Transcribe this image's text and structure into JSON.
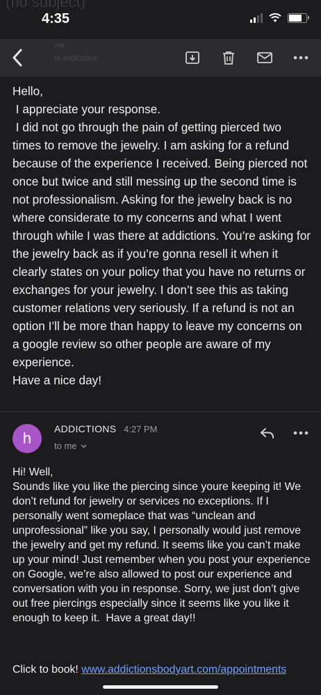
{
  "status_bar": {
    "time": "4:35",
    "ghost_subject": "(no subject)"
  },
  "toolbar": {
    "ghost_sender": "me",
    "ghost_sender_line2": "to addictions"
  },
  "email_body": {
    "text": "Hello,\n I appreciate your response.\n I did not go through the pain of getting pierced two times to remove the jewelry. I am asking for a refund because of the experience I received. Being pierced not once but twice and still messing up the second time is not professionalism. Asking for the jewelry back is no where considerate to my concerns and what I went through while I was there at addictions. You’re asking for the jewelry back as if you’re gonna resell it when it clearly states on your policy that you have no returns or exchanges for your jewelry. I don’t see this as taking customer relations very seriously. If a refund is not an option I’ll be more than happy to leave my concerns on a google review so other people are aware of my experience.\nHave a nice day!"
  },
  "reply": {
    "avatar_letter": "h",
    "sender": "ADDICTIONS",
    "time": "4:27 PM",
    "to": "to me",
    "text": "Hi! Well,\nSounds like you like the piercing since youre keeping it! We don’t refund for jewelry or services no exceptions. If I personally went someplace that was “unclean and unprofessional” like you say, I personally would just remove the jewelry and get my refund. It seems like you can’t make up your mind! Just remember when you post your experience on Google, we’re also allowed to post our experience and conversation with you in response. Sorry, we just don’t give out free piercings especially since it seems like you like it enough to keep it.  Have a great day!!",
    "book_prefix": "Click to book!",
    "book_link": "www.addictionsbodyart.com/appointments"
  },
  "colors": {
    "background": "#1c1c1e",
    "toolbar": "#2c2c2e",
    "avatar": "#a855c7",
    "link": "#6ea0ff"
  },
  "icons": [
    "back-icon",
    "archive-icon",
    "trash-icon",
    "mail-icon",
    "more-icon",
    "reply-icon"
  ]
}
